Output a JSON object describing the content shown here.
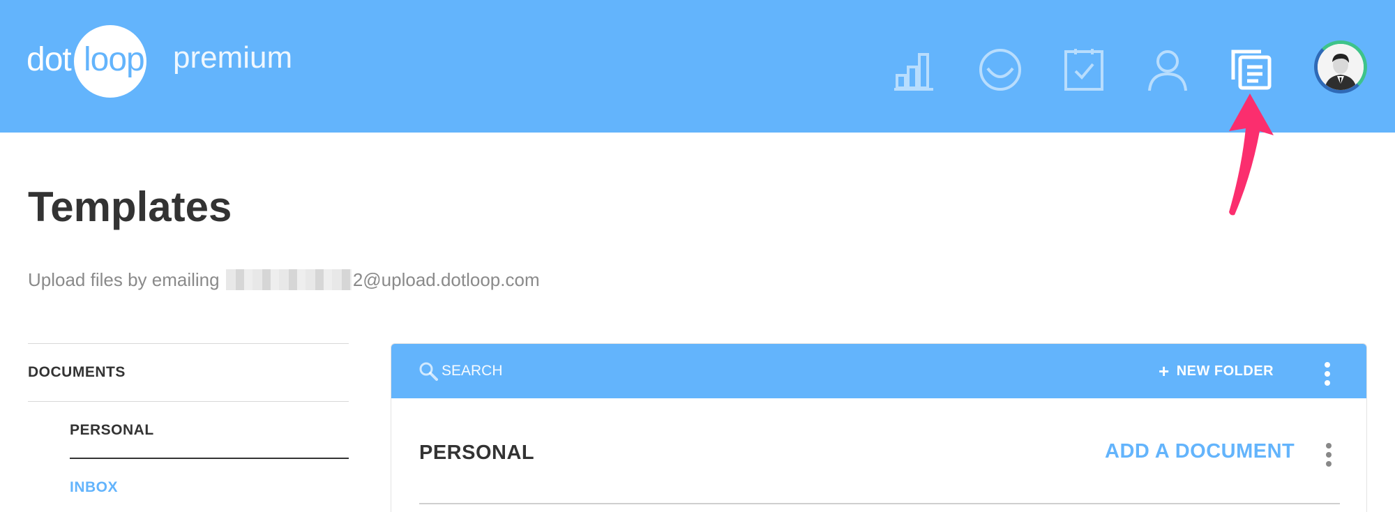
{
  "header": {
    "logo": {
      "part1": "dot",
      "part2": "loop",
      "edition": "premium"
    },
    "nav_icons": [
      "reports-icon",
      "loops-icon",
      "tasks-icon",
      "contacts-icon",
      "templates-icon"
    ],
    "accent_color": "#63b4fc"
  },
  "page": {
    "title": "Templates",
    "upload_prefix": "Upload files by emailing ",
    "upload_suffix": "2@upload.dotloop.com"
  },
  "sidebar": {
    "heading": "DOCUMENTS",
    "items": [
      {
        "label": "PERSONAL",
        "selected": true
      },
      {
        "label": "INBOX",
        "selected": false
      }
    ]
  },
  "panel": {
    "search_placeholder": "SEARCH",
    "new_folder_label": "NEW FOLDER",
    "section_title": "PERSONAL",
    "add_document_label": "ADD A DOCUMENT"
  }
}
